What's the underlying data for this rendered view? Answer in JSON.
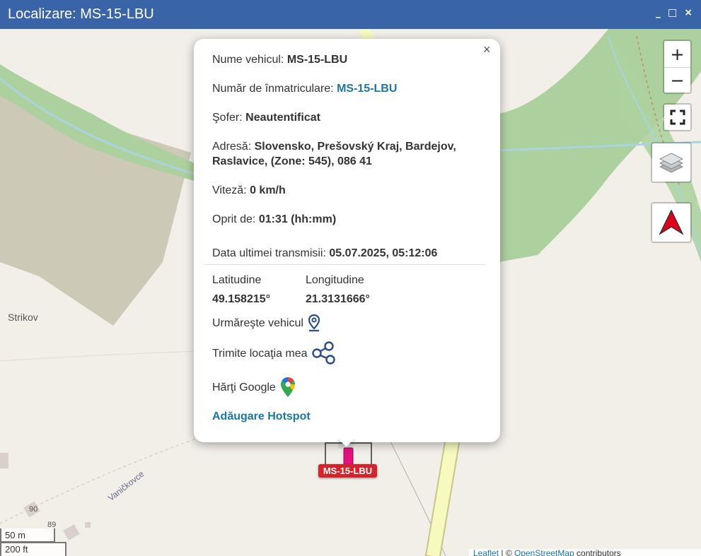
{
  "window": {
    "title": "Localizare: MS-15-LBU",
    "minimize": "_",
    "maximize": "□",
    "close": "×"
  },
  "map_controls": {
    "zoom_in": "+",
    "zoom_out": "−",
    "icons": [
      "fullscreen-icon",
      "layers-icon",
      "north-arrow-icon"
    ]
  },
  "map_labels": {
    "place": "Strikov",
    "street": "Vaničkovce",
    "house_numbers": [
      "90",
      "89"
    ]
  },
  "popup": {
    "close": "×",
    "vehicle_name_label": "Nume vehicul:",
    "vehicle_name": "MS-15-LBU",
    "plate_label": "Număr de înmatriculare:",
    "plate": "MS-15-LBU",
    "driver_label": "Şofer:",
    "driver": "Neautentificat",
    "address_label": "Adresă:",
    "address": "Slovensko, Prešovský Kraj, Bardejov, Raslavice, (Zone: 545), 086 41",
    "speed_label": "Viteză:",
    "speed": "0 km/h",
    "stopped_label": "Oprit de:",
    "stopped": "01:31 (hh:mm)",
    "last_tx_label": "Data ultimei transmisii:",
    "last_tx": "05.07.2025, 05:12:06",
    "lat_label": "Latitudine",
    "lat": "49.158215°",
    "lon_label": "Longitudine",
    "lon": "21.3131666°",
    "follow_label": "Urmăreşte vehicul",
    "share_label": "Trimite locaţia mea",
    "google_label": "Hărţi Google",
    "hotspot_label": "Adăugare Hotspot"
  },
  "marker": {
    "label": "MS-15-LBU",
    "color": "#d3242b"
  },
  "scale": {
    "metric": "50 m",
    "imperial": "200 ft"
  },
  "attribution": {
    "leaflet": "Leaflet",
    "sep": " | © ",
    "osm": "OpenStreetMap",
    "contrib": " contributors"
  },
  "colors": {
    "titlebar": "#3a64a8",
    "link": "#1b76a6",
    "forest": "#add19e",
    "road": "#f7fabf",
    "river": "#aad3df"
  }
}
